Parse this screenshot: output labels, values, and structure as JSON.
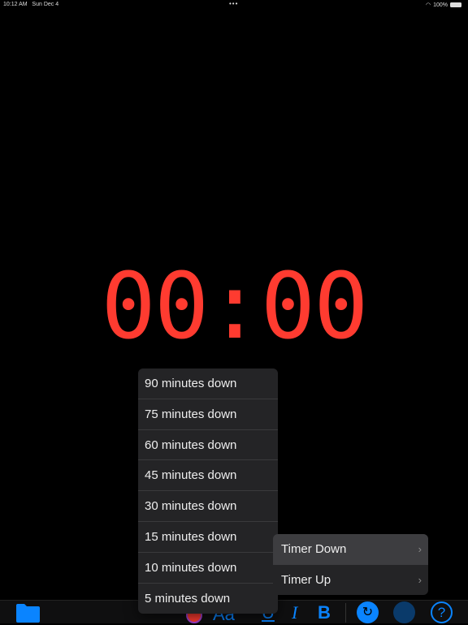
{
  "status": {
    "time": "10:12 AM",
    "date": "Sun Dec 4",
    "dots": "•••",
    "battery": "100%"
  },
  "timer": {
    "display": "00:00",
    "color": "#ff3b30"
  },
  "menu": {
    "items": [
      "90 minutes down",
      "75 minutes down",
      "60 minutes down",
      "45 minutes down",
      "30 minutes down",
      "15 minutes down",
      "10 minutes down",
      "5 minutes down"
    ]
  },
  "submenu": {
    "items": [
      {
        "label": "Timer Down",
        "active": true
      },
      {
        "label": "Timer Up",
        "active": false
      }
    ],
    "chevron": "›"
  },
  "toolbar": {
    "font_label": "Aa",
    "underline": "U",
    "italic": "I",
    "bold": "B",
    "help": "?",
    "accent": "#0a84ff"
  }
}
